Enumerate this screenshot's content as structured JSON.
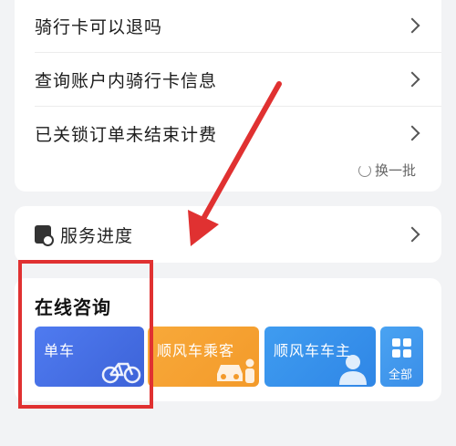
{
  "faq": {
    "items": [
      {
        "label": "骑行卡可以退吗"
      },
      {
        "label": "查询账户内骑行卡信息"
      },
      {
        "label": "已关锁订单未结束计费"
      }
    ],
    "refresh_label": "换一批"
  },
  "service": {
    "label": "服务进度"
  },
  "consult": {
    "title": "在线咨询",
    "tiles": [
      {
        "label": "单车",
        "icon": "bike-icon"
      },
      {
        "label": "顺风车乘客",
        "icon": "car-passenger-icon"
      },
      {
        "label": "顺风车车主",
        "icon": "person-icon"
      },
      {
        "label": "全部",
        "icon": "grid-icon"
      }
    ]
  },
  "colors": {
    "annotation": "#e03131",
    "bike_tile": "#3d63d8",
    "passenger_tile": "#f39a2a",
    "driver_tile": "#2f86e6"
  }
}
